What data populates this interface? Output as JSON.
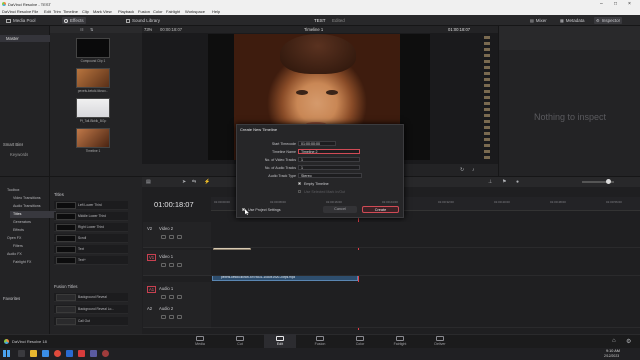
{
  "window": {
    "title": "DaVinci Resolve - TEST"
  },
  "menu": [
    "DaVinci Resolve",
    "File",
    "Edit",
    "Trim",
    "Timeline",
    "Clip",
    "Mark",
    "View",
    "Playback",
    "Fusion",
    "Color",
    "Fairlight",
    "Workspace",
    "Help"
  ],
  "toolbar": {
    "media_pool": "Media Pool",
    "effects": "Effects",
    "sound_library": "Sound Library",
    "project": "TEST",
    "edited": "Edited",
    "mixer": "Mixer",
    "metadata": "Metadata",
    "inspector": "Inspector",
    "zoom": "73%",
    "source_tc": "00:00:18:07",
    "timeline_name": "Timeline 1",
    "record_tc": "01:00:18:07"
  },
  "bins": {
    "master": "Master",
    "smart_bins": "Smart Bins",
    "keywords": "Keywords"
  },
  "media_pool": {
    "clips": [
      {
        "label": "Compound Clip 1"
      },
      {
        "label": "pexels-ketoki-tiknov..."
      },
      {
        "label": "Pf_Tall-Bkblk_BGp"
      },
      {
        "label": "Timeline 1"
      }
    ]
  },
  "inspector": {
    "empty": "Nothing to inspect"
  },
  "effects_tree": {
    "items": [
      "Toolbox",
      "Video Transitions",
      "Audio Transitions",
      "Titles",
      "Generators",
      "Effects",
      "Open FX",
      "Filters",
      "Audio FX",
      "Fairlight FX"
    ],
    "favorites": "Favorites"
  },
  "titles": {
    "header": "Titles",
    "items": [
      "Left Lower Third",
      "Middle Lower Third",
      "Right Lower Third",
      "Scroll",
      "Text",
      "Text+"
    ],
    "fusion_header": "Fusion Titles",
    "fusion_items": [
      "Background Reveal",
      "Background Reveal Lo...",
      "Call Out"
    ]
  },
  "timeline": {
    "timecode": "01:00:18:07",
    "ruler": [
      "01:00:00:00",
      "01:00:08:00",
      "01:00:16:00",
      "01:00:24:00",
      "01:00:32:00",
      "01:00:40:00",
      "01:00:48:00",
      "01:00:56:00"
    ],
    "tracks": [
      {
        "id": "V2",
        "name": "Video 2"
      },
      {
        "id": "V1",
        "name": "Video 1"
      },
      {
        "id": "A1",
        "name": "Audio 1"
      },
      {
        "id": "A2",
        "name": "Audio 2"
      }
    ],
    "text_clip": "T",
    "video_clip": "pexels-ketoki-tiknov-6979831-1080x1920-25fps.mp4"
  },
  "dialog": {
    "title": "Create New Timeline",
    "fields": [
      {
        "label": "Start Timecode",
        "value": "01:00:00:00"
      },
      {
        "label": "Timeline Name",
        "value": "Timeline 2"
      },
      {
        "label": "No. of Video Tracks",
        "value": "1"
      },
      {
        "label": "No. of Audio Tracks",
        "value": "1"
      },
      {
        "label": "Audio Track Type",
        "value": "Stereo"
      }
    ],
    "empty_timeline": "Empty Timeline",
    "use_selected": "Use Selected Mark In/Out",
    "use_project_settings": "Use Project Settings",
    "cancel": "Cancel",
    "create": "Create"
  },
  "pages": [
    "Media",
    "Cut",
    "Edit",
    "Fusion",
    "Color",
    "Fairlight",
    "Deliver"
  ],
  "app_name": "DaVinci Resolve 18",
  "taskbar": {
    "time": "9:10 AM",
    "date": "2/12/2023"
  }
}
